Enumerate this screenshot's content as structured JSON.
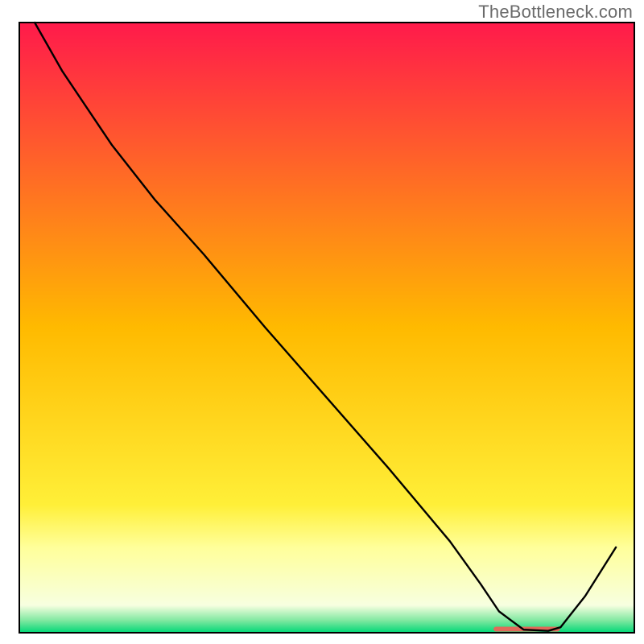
{
  "watermark": {
    "text": "TheBottleneck.com"
  },
  "chart_data": {
    "type": "line",
    "title": "",
    "xlabel": "",
    "ylabel": "",
    "xlim": [
      0,
      100
    ],
    "ylim": [
      0,
      100
    ],
    "grid": false,
    "legend": false,
    "background_gradient": {
      "stops": [
        {
          "offset": 0.0,
          "color": "#ff1a4b"
        },
        {
          "offset": 0.5,
          "color": "#ffba00"
        },
        {
          "offset": 0.79,
          "color": "#ffef38"
        },
        {
          "offset": 0.86,
          "color": "#ffff9a"
        },
        {
          "offset": 0.955,
          "color": "#f7ffe0"
        },
        {
          "offset": 0.98,
          "color": "#7fe8a0"
        },
        {
          "offset": 1.0,
          "color": "#00d776"
        }
      ]
    },
    "series": [
      {
        "name": "bottleneck-curve",
        "color": "#000000",
        "stroke_width": 2.4,
        "x": [
          2.5,
          7,
          15,
          22,
          30,
          40,
          50,
          60,
          70,
          75,
          78,
          82,
          86,
          88,
          92,
          97
        ],
        "y": [
          100,
          92,
          80,
          71,
          62,
          50,
          38.5,
          27,
          15,
          8,
          3.5,
          0.5,
          0.3,
          0.9,
          6,
          14
        ]
      }
    ],
    "annotations": [
      {
        "name": "optimal-band",
        "type": "segment",
        "color": "#e06a5a",
        "stroke_width": 6,
        "x0": 77.5,
        "y0": 0.6,
        "x1": 87.5,
        "y1": 0.6
      }
    ]
  }
}
